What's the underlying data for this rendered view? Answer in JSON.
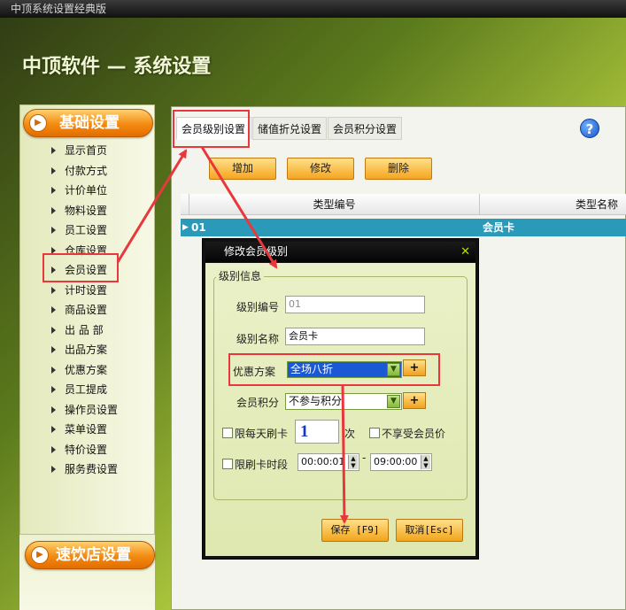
{
  "window": {
    "title": "中顶系统设置经典版"
  },
  "header": {
    "title": "中顶软件 — 系统设置"
  },
  "sidebar": {
    "section_basic": "基础设置",
    "section_fastfood": "速饮店设置",
    "items": [
      {
        "label": "显示首页"
      },
      {
        "label": "付款方式"
      },
      {
        "label": "计价单位"
      },
      {
        "label": "物料设置"
      },
      {
        "label": "员工设置"
      },
      {
        "label": "仓库设置"
      },
      {
        "label": "会员设置"
      },
      {
        "label": "计时设置"
      },
      {
        "label": "商品设置"
      },
      {
        "label": "出 品 部"
      },
      {
        "label": "出品方案"
      },
      {
        "label": "优惠方案"
      },
      {
        "label": "员工提成"
      },
      {
        "label": "操作员设置"
      },
      {
        "label": "菜单设置"
      },
      {
        "label": "特价设置"
      },
      {
        "label": "服务费设置"
      }
    ]
  },
  "tabs": [
    {
      "label": "会员级别设置"
    },
    {
      "label": "储值折兑设置"
    },
    {
      "label": "会员积分设置"
    }
  ],
  "toolbar": {
    "add": "增加",
    "edit": "修改",
    "delete": "删除",
    "help_glyph": "?"
  },
  "grid": {
    "columns": [
      "类型编号",
      "类型名称"
    ],
    "rows": [
      {
        "code": "01",
        "name": "会员卡"
      }
    ]
  },
  "dialog": {
    "title": "修改会员级别",
    "close_glyph": "✕",
    "group_title": "级别信息",
    "level_code_label": "级别编号",
    "level_code_value": "01",
    "level_name_label": "级别名称",
    "level_name_value": "会员卡",
    "discount_label": "优惠方案",
    "discount_value": "全场八折",
    "points_label": "会员积分",
    "points_value": "不参与积分",
    "plus_glyph": "+",
    "daily_limit_label": "限每天刷卡",
    "daily_limit_value": "1",
    "daily_limit_unit": "次",
    "no_member_price_label": "不享受会员价",
    "time_limit_label": "限刷卡时段",
    "time_from": "00:00:01",
    "time_sep": "-",
    "time_to": "09:00:00",
    "save": "保存 [F9]",
    "cancel": "取消[Esc]"
  },
  "colors": {
    "accent_orange": "#f28a10",
    "selected_row": "#2b9ab8",
    "annotation_red": "#e8383d",
    "dialog_frame": "#111111"
  }
}
